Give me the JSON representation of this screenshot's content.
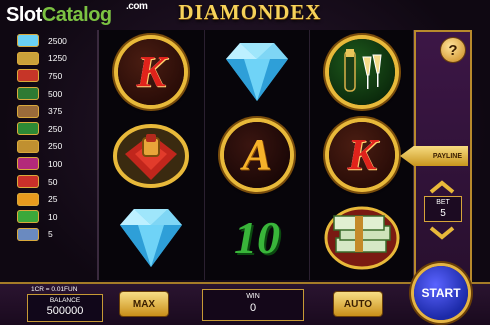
{
  "watermark": {
    "a": "Slot",
    "b": "Catalog",
    "c": ".com"
  },
  "game_title": "DIAMONDEX",
  "paytable": [
    {
      "icon": "diamond-icon",
      "value": "2500",
      "color": "#6ad2f5"
    },
    {
      "icon": "coins-icon",
      "value": "1250",
      "color": "#c9a13a"
    },
    {
      "icon": "ring-icon",
      "value": "750",
      "color": "#c63528"
    },
    {
      "icon": "champagne-icon",
      "value": "500",
      "color": "#2e7a33"
    },
    {
      "icon": "money-icon",
      "value": "375",
      "color": "#9a6b3a"
    },
    {
      "icon": "ten-icon",
      "value": "250",
      "color": "#2d8a35"
    },
    {
      "icon": "jack-icon",
      "value": "250",
      "color": "#c09030"
    },
    {
      "icon": "queen-icon",
      "value": "100",
      "color": "#b32a7a"
    },
    {
      "icon": "king-icon",
      "value": "50",
      "color": "#c9302a"
    },
    {
      "icon": "ace-icon",
      "value": "25",
      "color": "#e79a1e"
    },
    {
      "icon": "ten-small-icon",
      "value": "10",
      "color": "#3aa83a"
    },
    {
      "icon": "nine-icon",
      "value": "5",
      "color": "#6a8ac0"
    }
  ],
  "reels": [
    [
      "K",
      "ring",
      "diamond"
    ],
    [
      "diamond",
      "A",
      "10"
    ],
    [
      "champagne",
      "K",
      "money"
    ]
  ],
  "buttons": {
    "help": "?",
    "payline": "PAYLINE",
    "max": "MAX",
    "auto": "AUTO",
    "start": "START"
  },
  "bet": {
    "label": "BET",
    "value": "5"
  },
  "footer": {
    "credit": "1CR = 0.01FUN",
    "balance_label": "BALANCE",
    "balance_value": "500000",
    "win_label": "WIN",
    "win_value": "0"
  },
  "colors": {
    "gold": "#e8b93a",
    "panel": "#3c1646",
    "start": "#2b39d0"
  }
}
